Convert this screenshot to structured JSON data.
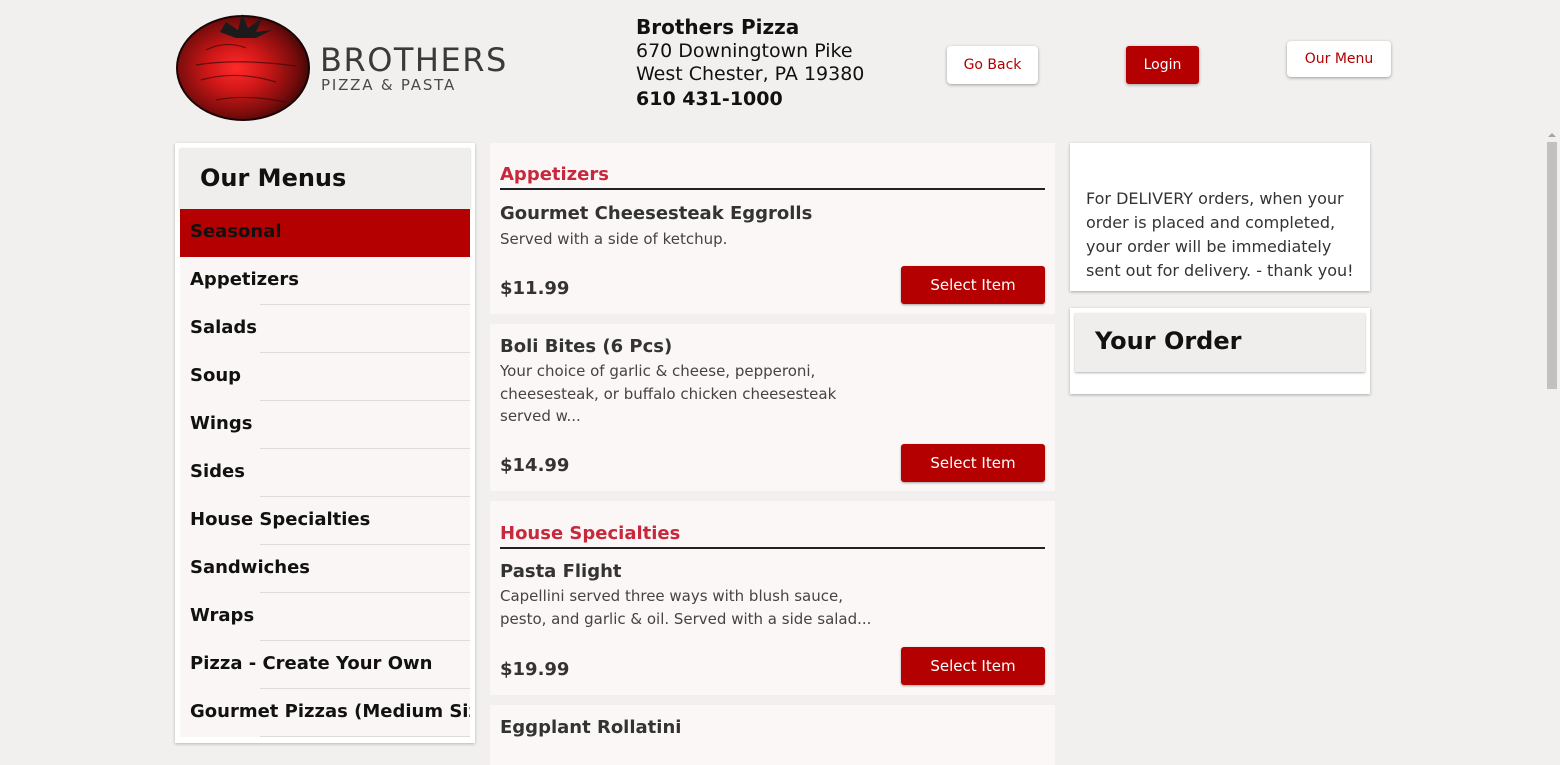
{
  "brand": {
    "logo_line1": "BROTHERS",
    "logo_line2": "PIZZA & PASTA"
  },
  "store": {
    "name": "Brothers Pizza",
    "address_line1": "670 Downingtown Pike",
    "address_line2": "West Chester, PA 19380",
    "phone": "610 431-1000"
  },
  "header_buttons": {
    "go_back": "Go Back",
    "login": "Login",
    "our_menu": "Our Menu"
  },
  "sidebar": {
    "title": "Our Menus",
    "items": [
      {
        "label": "Seasonal",
        "active": true
      },
      {
        "label": "Appetizers"
      },
      {
        "label": "Salads"
      },
      {
        "label": "Soup"
      },
      {
        "label": "Wings"
      },
      {
        "label": "Sides"
      },
      {
        "label": "House Specialties"
      },
      {
        "label": "Sandwiches"
      },
      {
        "label": "Wraps"
      },
      {
        "label": "Pizza - Create Your Own"
      },
      {
        "label": "Gourmet Pizzas (Medium Siz"
      }
    ]
  },
  "menu": {
    "select_label": "Select Item",
    "sections": [
      {
        "title": "Appetizers",
        "items": [
          {
            "name": "Gourmet Cheesesteak Eggrolls",
            "description": "Served with a side of ketchup.",
            "price": "$11.99"
          },
          {
            "name": "Boli Bites (6 Pcs)",
            "description": "Your choice of garlic & cheese, pepperoni, cheesesteak, or buffalo chicken cheesesteak served w...",
            "price": "$14.99"
          }
        ]
      },
      {
        "title": "House Specialties",
        "items": [
          {
            "name": "Pasta Flight",
            "description": "Capellini served three ways with blush sauce, pesto, and garlic & oil. Served with a side salad...",
            "price": "$19.99"
          },
          {
            "name": "Eggplant Rollatini"
          }
        ]
      }
    ]
  },
  "notice": {
    "text": "For DELIVERY orders, when your order is placed and completed, your order will be immediately sent out for delivery. - thank you!"
  },
  "order": {
    "title": "Your Order"
  },
  "colors": {
    "brand_red": "#b40000",
    "section_title_red": "#c8283c",
    "page_bg": "#f1f0ef"
  }
}
